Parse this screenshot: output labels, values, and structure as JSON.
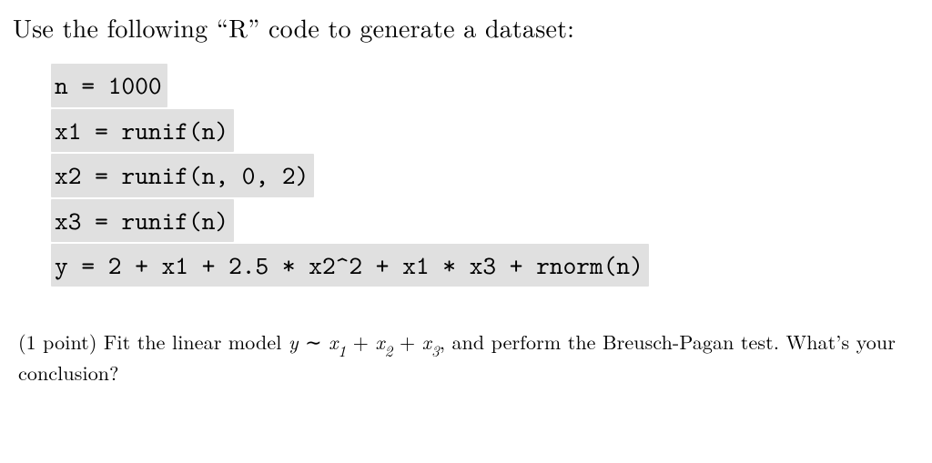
{
  "intro": "Use the following “R” code to generate a dataset:",
  "code": {
    "l1": "n = 1000",
    "l2": "x1 = runif(n)",
    "l3": "x2 = runif(n, 0, 2)",
    "l4": "x3 = runif(n)",
    "l5": "y = 2 + x1 + 2.5 * x2^2 + x1 * x3 + rnorm(n)"
  },
  "question": {
    "points_label": "(1 point)",
    "part1": "Fit the linear model ",
    "model_y": "y",
    "tilde": "∼",
    "model_x1": "x",
    "sub1": "1",
    "plus1": "+",
    "model_x2": "x",
    "sub2": "2",
    "plus2": "+",
    "model_x3": "x",
    "sub3": "3",
    "part2": ", and perform the Breusch-Pagan test. What’s your conclusion?"
  }
}
